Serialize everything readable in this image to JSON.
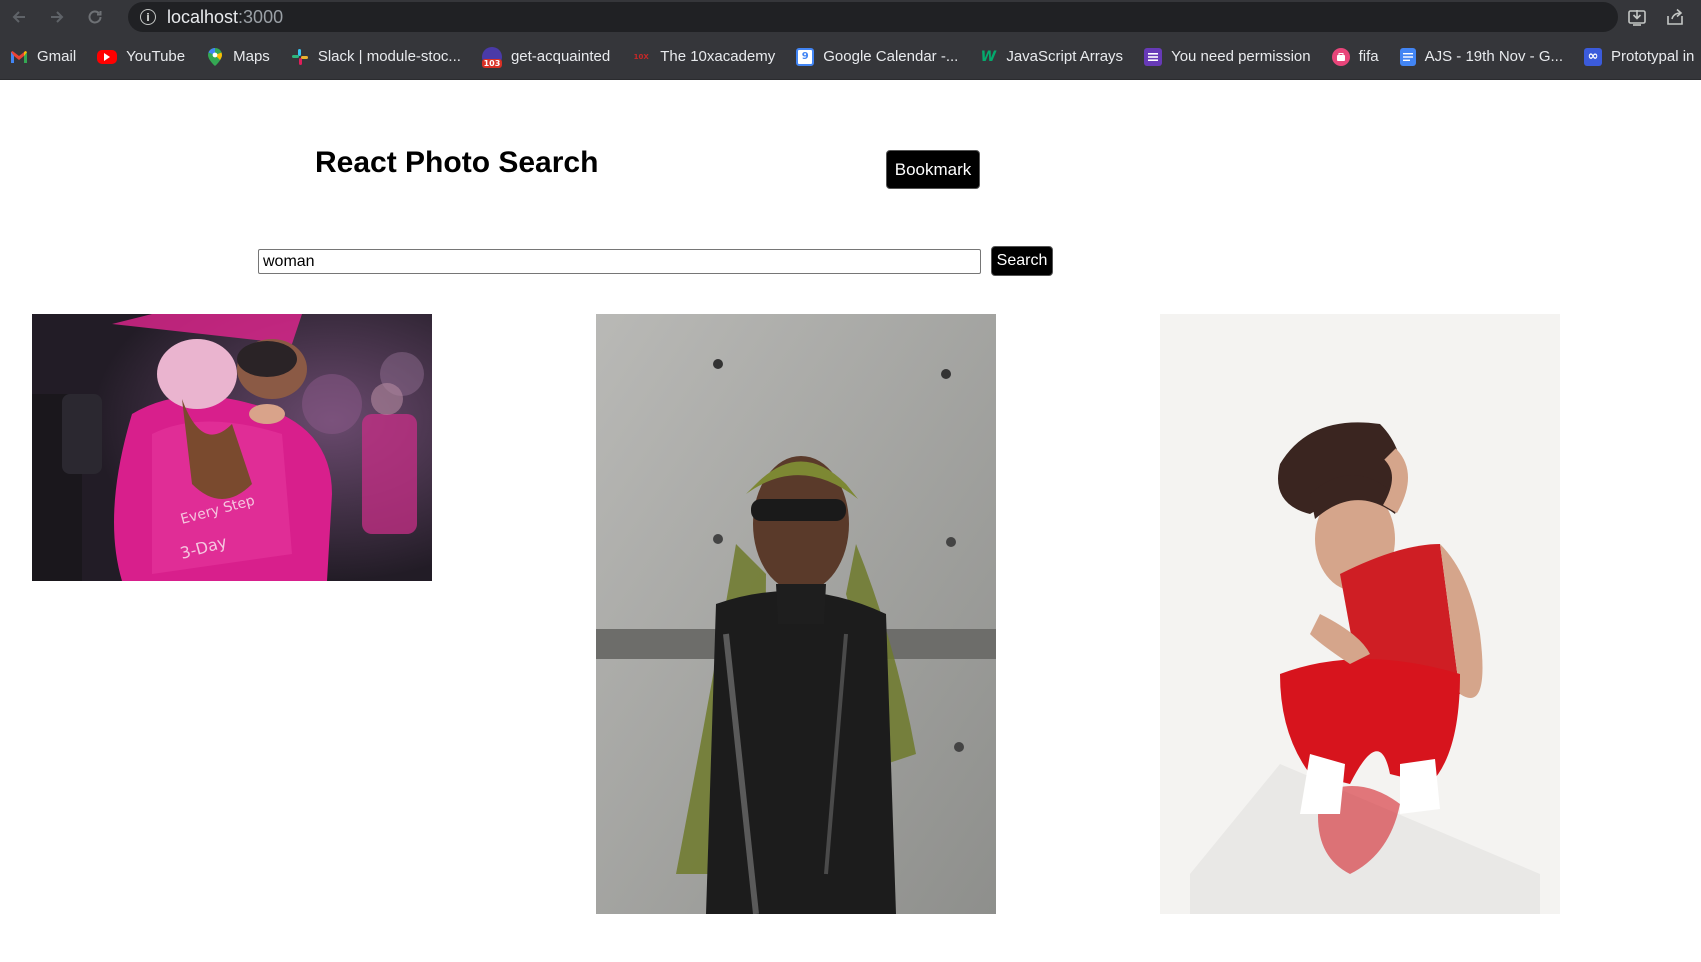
{
  "browser": {
    "url_host": "localhost",
    "url_port": ":3000",
    "bookmarks": [
      {
        "label": "Gmail",
        "icon": "gmail-icon",
        "color": "#ea4335"
      },
      {
        "label": "YouTube",
        "icon": "youtube-icon",
        "color": "#ff0000"
      },
      {
        "label": "Maps",
        "icon": "maps-icon",
        "color": "#34a853"
      },
      {
        "label": "Slack | module-stoc...",
        "icon": "slack-icon",
        "color": "#e01e5a"
      },
      {
        "label": "get-acquainted",
        "icon": "calendar-badge-icon",
        "badge": "103",
        "color": "#4a3aa8"
      },
      {
        "label": "The 10xacademy",
        "icon": "10x-icon",
        "badge": "10X",
        "color": "#c62828"
      },
      {
        "label": "Google Calendar -...",
        "icon": "google-calendar-icon",
        "badge": "9",
        "color": "#4285f4"
      },
      {
        "label": "JavaScript Arrays",
        "icon": "w3schools-icon",
        "badge": "W",
        "color": "#04aa6d"
      },
      {
        "label": "You need permission",
        "icon": "google-forms-icon",
        "color": "#673ab7"
      },
      {
        "label": "fifa",
        "icon": "fifa-icon",
        "color": "#e8457a"
      },
      {
        "label": "AJS - 19th Nov - G...",
        "icon": "google-docs-icon",
        "color": "#4285f4"
      },
      {
        "label": "Prototypal in",
        "icon": "infinity-icon",
        "badge": "∞",
        "color": "#3b5bdb"
      }
    ]
  },
  "page": {
    "title": "React Photo Search",
    "bookmark_button": "Bookmark",
    "search": {
      "value": "woman",
      "button": "Search"
    }
  }
}
